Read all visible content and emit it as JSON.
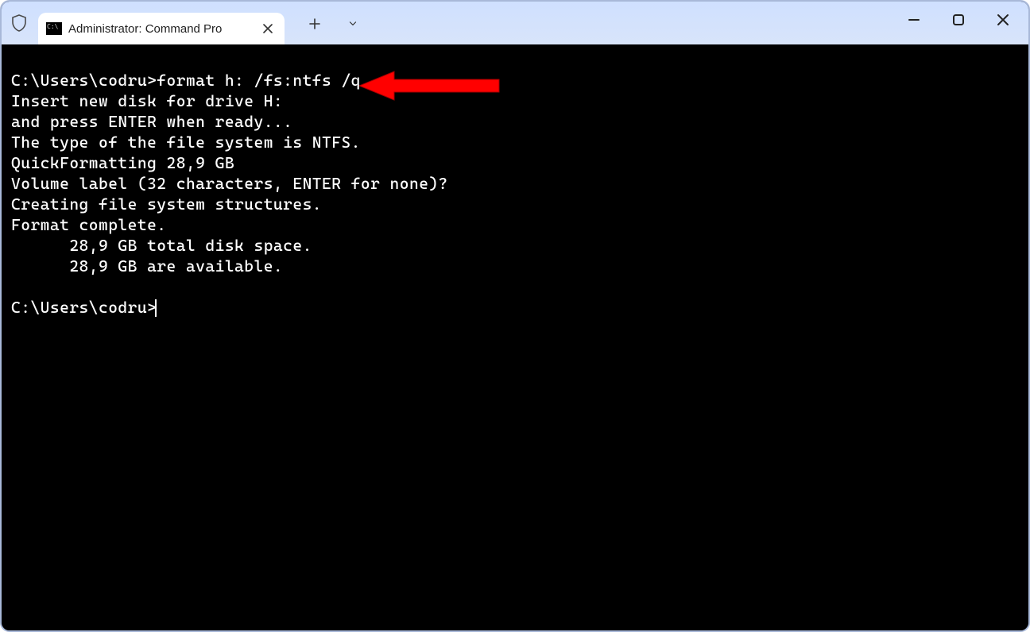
{
  "tab": {
    "title": "Administrator: Command Pro"
  },
  "terminal": {
    "lines": [
      "C:\\Users\\codru>format h: /fs:ntfs /q",
      "Insert new disk for drive H:",
      "and press ENTER when ready...",
      "The type of the file system is NTFS.",
      "QuickFormatting 28,9 GB",
      "Volume label (32 characters, ENTER for none)?",
      "Creating file system structures.",
      "Format complete.",
      "      28,9 GB total disk space.",
      "      28,9 GB are available.",
      "",
      "C:\\Users\\codru>"
    ]
  }
}
